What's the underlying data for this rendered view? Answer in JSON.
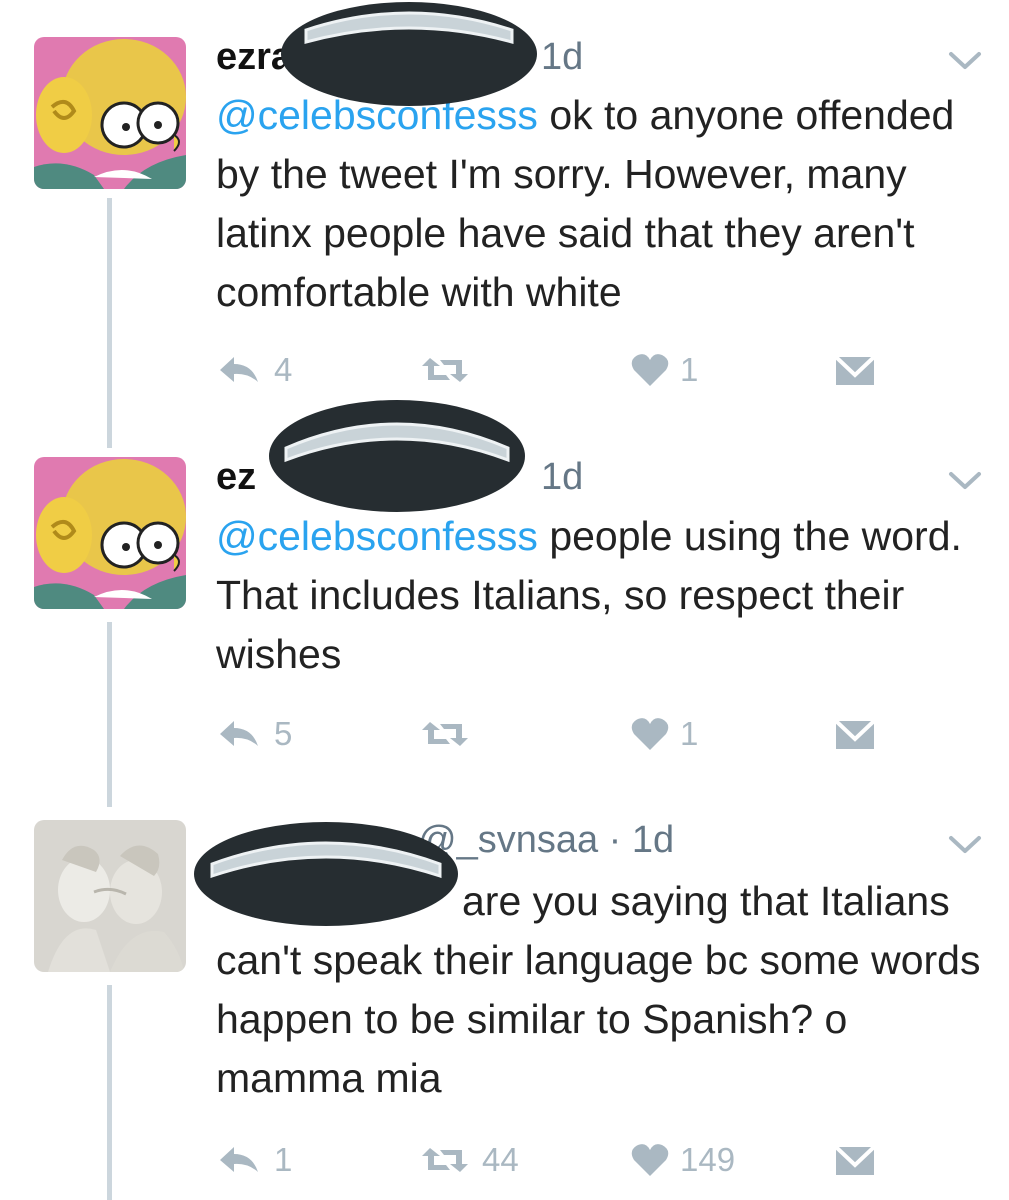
{
  "tweets": [
    {
      "name": "ezra",
      "handle": "",
      "time": "1d",
      "mention": "@celebsconfesss",
      "text": " ok to anyone offended by the tweet I'm sorry. However, many latinx people have said that they aren't comfortable with white",
      "replies": "4",
      "retweets": "",
      "likes": "1",
      "avatar": "simpsons-character-avatar"
    },
    {
      "name": "ez",
      "handle": "",
      "time": "1d",
      "mention": "@celebsconfesss",
      "text": " people using the word. That includes Italians, so respect their wishes",
      "replies": "5",
      "retweets": "",
      "likes": "1",
      "avatar": "simpsons-character-avatar"
    },
    {
      "name": "",
      "handle": "@_svnsaa · 1d",
      "time": "",
      "mention": "",
      "text": "are you saying that Italians can't speak their language bc some words happen to be similar to Spanish? o mamma mia",
      "replies": "1",
      "retweets": "44",
      "likes": "149",
      "avatar": "statue-kiss-avatar"
    }
  ],
  "icons": {
    "reply": "reply-icon",
    "retweet": "retweet-icon",
    "like": "heart-icon",
    "dm": "envelope-icon",
    "more": "chevron-down-icon"
  },
  "colors": {
    "mention": "#2aa3ef",
    "action_gray": "#aab8c2",
    "redaction": "#262d31"
  }
}
